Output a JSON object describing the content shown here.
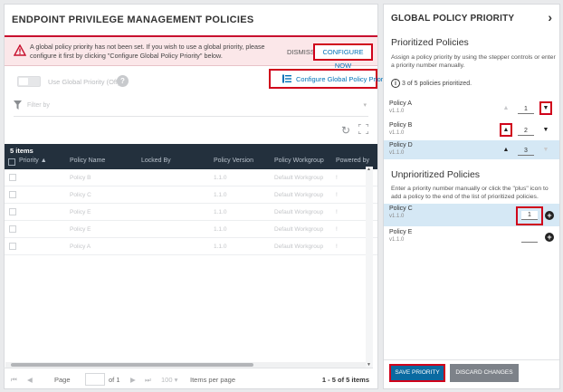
{
  "left": {
    "title": "ENDPOINT PRIVILEGE MANAGEMENT POLICIES",
    "alert": {
      "message": "A global policy priority has not been set. If you wish to use a global priority, please configure it first by clicking \"Configure Global Policy Priority\" below.",
      "dismiss": "DISMISS",
      "configure": "CONFIGURE NOW"
    },
    "toggle_label": "Use Global Priority (Off)",
    "configure_button": "Configure Global Policy Priority",
    "filter_placeholder": "Filter by",
    "grid": {
      "count": "5 items",
      "columns": [
        "Priority ▲",
        "Policy Name",
        "Locked By",
        "Policy Version",
        "Policy Workgroup",
        "Powered by"
      ],
      "rows": [
        {
          "name": "Policy B",
          "version": "1.1.0",
          "workgroup": "Default Workgroup",
          "powered": "!"
        },
        {
          "name": "Policy C",
          "version": "1.1.0",
          "workgroup": "Default Workgroup",
          "powered": "!"
        },
        {
          "name": "Policy E",
          "version": "1.1.0",
          "workgroup": "Default Workgroup",
          "powered": "!"
        },
        {
          "name": "Policy E",
          "version": "1.1.0",
          "workgroup": "Default Workgroup",
          "powered": "!"
        },
        {
          "name": "Policy A",
          "version": "1.1.0",
          "workgroup": "Default Workgroup",
          "powered": "!"
        }
      ]
    },
    "pager": {
      "page_label": "Page",
      "of": "of 1",
      "size": "100",
      "items_per_page": "Items per page",
      "range": "1 - 5 of 5 items"
    }
  },
  "right": {
    "title": "GLOBAL POLICY PRIORITY",
    "prioritized_title": "Prioritized Policies",
    "prioritized_desc": "Assign a policy priority by using the stepper controls or enter a priority number manually.",
    "info": "3 of 5 policies prioritized.",
    "prioritized": [
      {
        "name": "Policy A",
        "version": "v1.1.0",
        "priority": "1"
      },
      {
        "name": "Policy B",
        "version": "v1.1.0",
        "priority": "2"
      },
      {
        "name": "Policy D",
        "version": "v1.1.0",
        "priority": "3"
      }
    ],
    "unprioritized_title": "Unprioritized Policies",
    "unprioritized_desc": "Enter a priority number manually or click the \"plus\" icon to add a policy to the end of the list of prioritized policies.",
    "unprioritized": [
      {
        "name": "Policy C",
        "version": "v1.1.0",
        "priority": "1"
      },
      {
        "name": "Policy E",
        "version": "v1.1.0",
        "priority": ""
      }
    ],
    "save": "SAVE PRIORITY",
    "discard": "DISCARD CHANGES"
  },
  "colors": {
    "accent_red": "#d0021b",
    "link_blue": "#0072b8",
    "grid_header": "#23303d",
    "save_blue": "#0a6aa1"
  }
}
